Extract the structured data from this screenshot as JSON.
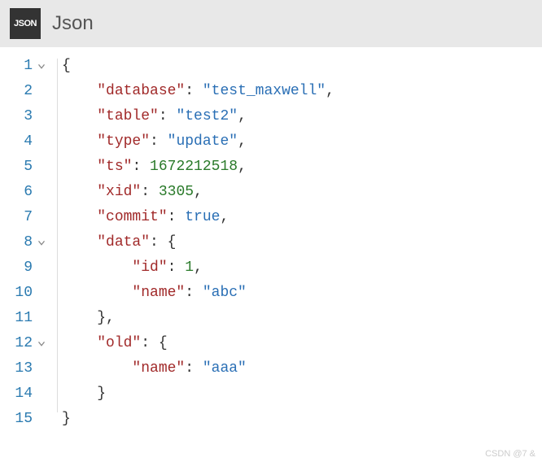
{
  "header": {
    "badge": "JSON",
    "title": "Json"
  },
  "editor": {
    "lines": [
      {
        "num": "1",
        "fold": true,
        "indent": 0,
        "tokens": [
          [
            "punc",
            "{"
          ]
        ]
      },
      {
        "num": "2",
        "fold": false,
        "indent": 1,
        "tokens": [
          [
            "key",
            "\"database\""
          ],
          [
            "punc",
            ": "
          ],
          [
            "str",
            "\"test_maxwell\""
          ],
          [
            "punc",
            ","
          ]
        ]
      },
      {
        "num": "3",
        "fold": false,
        "indent": 1,
        "tokens": [
          [
            "key",
            "\"table\""
          ],
          [
            "punc",
            ": "
          ],
          [
            "str",
            "\"test2\""
          ],
          [
            "punc",
            ","
          ]
        ]
      },
      {
        "num": "4",
        "fold": false,
        "indent": 1,
        "tokens": [
          [
            "key",
            "\"type\""
          ],
          [
            "punc",
            ": "
          ],
          [
            "str",
            "\"update\""
          ],
          [
            "punc",
            ","
          ]
        ]
      },
      {
        "num": "5",
        "fold": false,
        "indent": 1,
        "tokens": [
          [
            "key",
            "\"ts\""
          ],
          [
            "punc",
            ": "
          ],
          [
            "num",
            "1672212518"
          ],
          [
            "punc",
            ","
          ]
        ]
      },
      {
        "num": "6",
        "fold": false,
        "indent": 1,
        "tokens": [
          [
            "key",
            "\"xid\""
          ],
          [
            "punc",
            ": "
          ],
          [
            "num",
            "3305"
          ],
          [
            "punc",
            ","
          ]
        ]
      },
      {
        "num": "7",
        "fold": false,
        "indent": 1,
        "tokens": [
          [
            "key",
            "\"commit\""
          ],
          [
            "punc",
            ": "
          ],
          [
            "bool",
            "true"
          ],
          [
            "punc",
            ","
          ]
        ]
      },
      {
        "num": "8",
        "fold": true,
        "indent": 1,
        "tokens": [
          [
            "key",
            "\"data\""
          ],
          [
            "punc",
            ": {"
          ]
        ]
      },
      {
        "num": "9",
        "fold": false,
        "indent": 2,
        "tokens": [
          [
            "key",
            "\"id\""
          ],
          [
            "punc",
            ": "
          ],
          [
            "num",
            "1"
          ],
          [
            "punc",
            ","
          ]
        ]
      },
      {
        "num": "10",
        "fold": false,
        "indent": 2,
        "tokens": [
          [
            "key",
            "\"name\""
          ],
          [
            "punc",
            ": "
          ],
          [
            "str",
            "\"abc\""
          ]
        ]
      },
      {
        "num": "11",
        "fold": false,
        "indent": 1,
        "tokens": [
          [
            "punc",
            "},"
          ]
        ]
      },
      {
        "num": "12",
        "fold": true,
        "indent": 1,
        "tokens": [
          [
            "key",
            "\"old\""
          ],
          [
            "punc",
            ": {"
          ]
        ]
      },
      {
        "num": "13",
        "fold": false,
        "indent": 2,
        "tokens": [
          [
            "key",
            "\"name\""
          ],
          [
            "punc",
            ": "
          ],
          [
            "str",
            "\"aaa\""
          ]
        ]
      },
      {
        "num": "14",
        "fold": false,
        "indent": 1,
        "tokens": [
          [
            "punc",
            "}"
          ]
        ]
      },
      {
        "num": "15",
        "fold": false,
        "indent": 0,
        "tokens": [
          [
            "punc",
            "}"
          ]
        ]
      }
    ]
  },
  "watermark": "CSDN @7 &"
}
